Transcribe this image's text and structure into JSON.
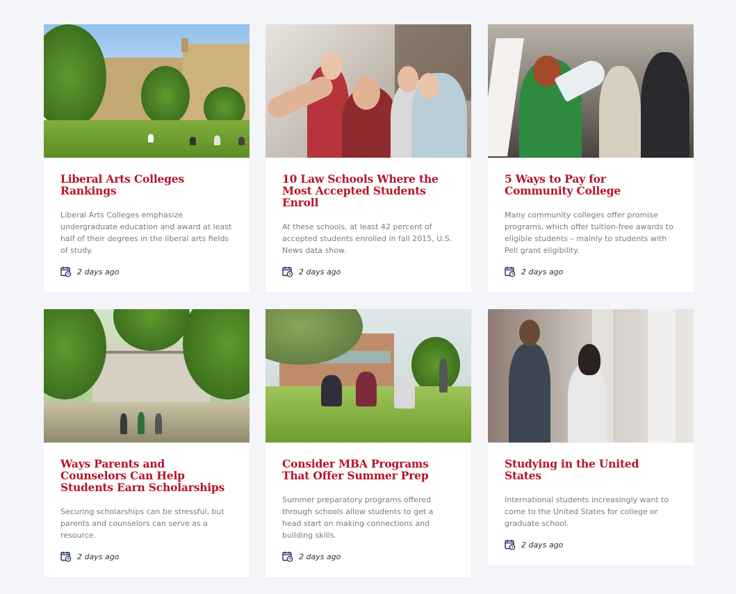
{
  "posts": [
    {
      "title": "Liberal Arts Colleges Rankings",
      "desc": "Liberal Arts Colleges emphasize undergraduate education and award at least half of their degrees in the liberal arts fields of study.",
      "date": "2 days ago",
      "image": "campus-lawn-photo"
    },
    {
      "title": "Ways Parents and Counselors Can Help Students Earn Scholarships",
      "desc": "Securing scholarships can be stressful, but parents and counselors can serve as a resource.",
      "date": "2 days ago",
      "image": "campus-library-trees-photo"
    },
    {
      "title": "10 Law Schools Where the Most Accepted Students Enroll",
      "desc": "At these schools, at least 42 percent of accepted students enrolled in fall 2015, U.S. News data show.",
      "date": "2 days ago",
      "image": "students-selfie-photo"
    },
    {
      "title": "Consider MBA Programs That Offer Summer Prep",
      "desc": "Summer preparatory programs offered through schools allow students to get a head start on making connections and building skills.",
      "date": "2 days ago",
      "image": "students-on-grass-photo"
    },
    {
      "title": "5 Ways to Pay for Community College",
      "desc": "Many community colleges offer promise programs, which offer tuition-free awards to eligible students – mainly to students with Pell grant eligibility.",
      "date": "2 days ago",
      "image": "protest-megaphone-photo"
    },
    {
      "title": "Studying in the United States",
      "desc": "International students increasingly want to come to the United States for college or graduate school.",
      "date": "2 days ago",
      "image": "students-walking-corridor-photo"
    }
  ],
  "colors": {
    "title": "#b5142b",
    "background": "#f4f5f9",
    "icon": "#1f3060"
  },
  "icons": {
    "date": "calendar-clock-icon"
  }
}
